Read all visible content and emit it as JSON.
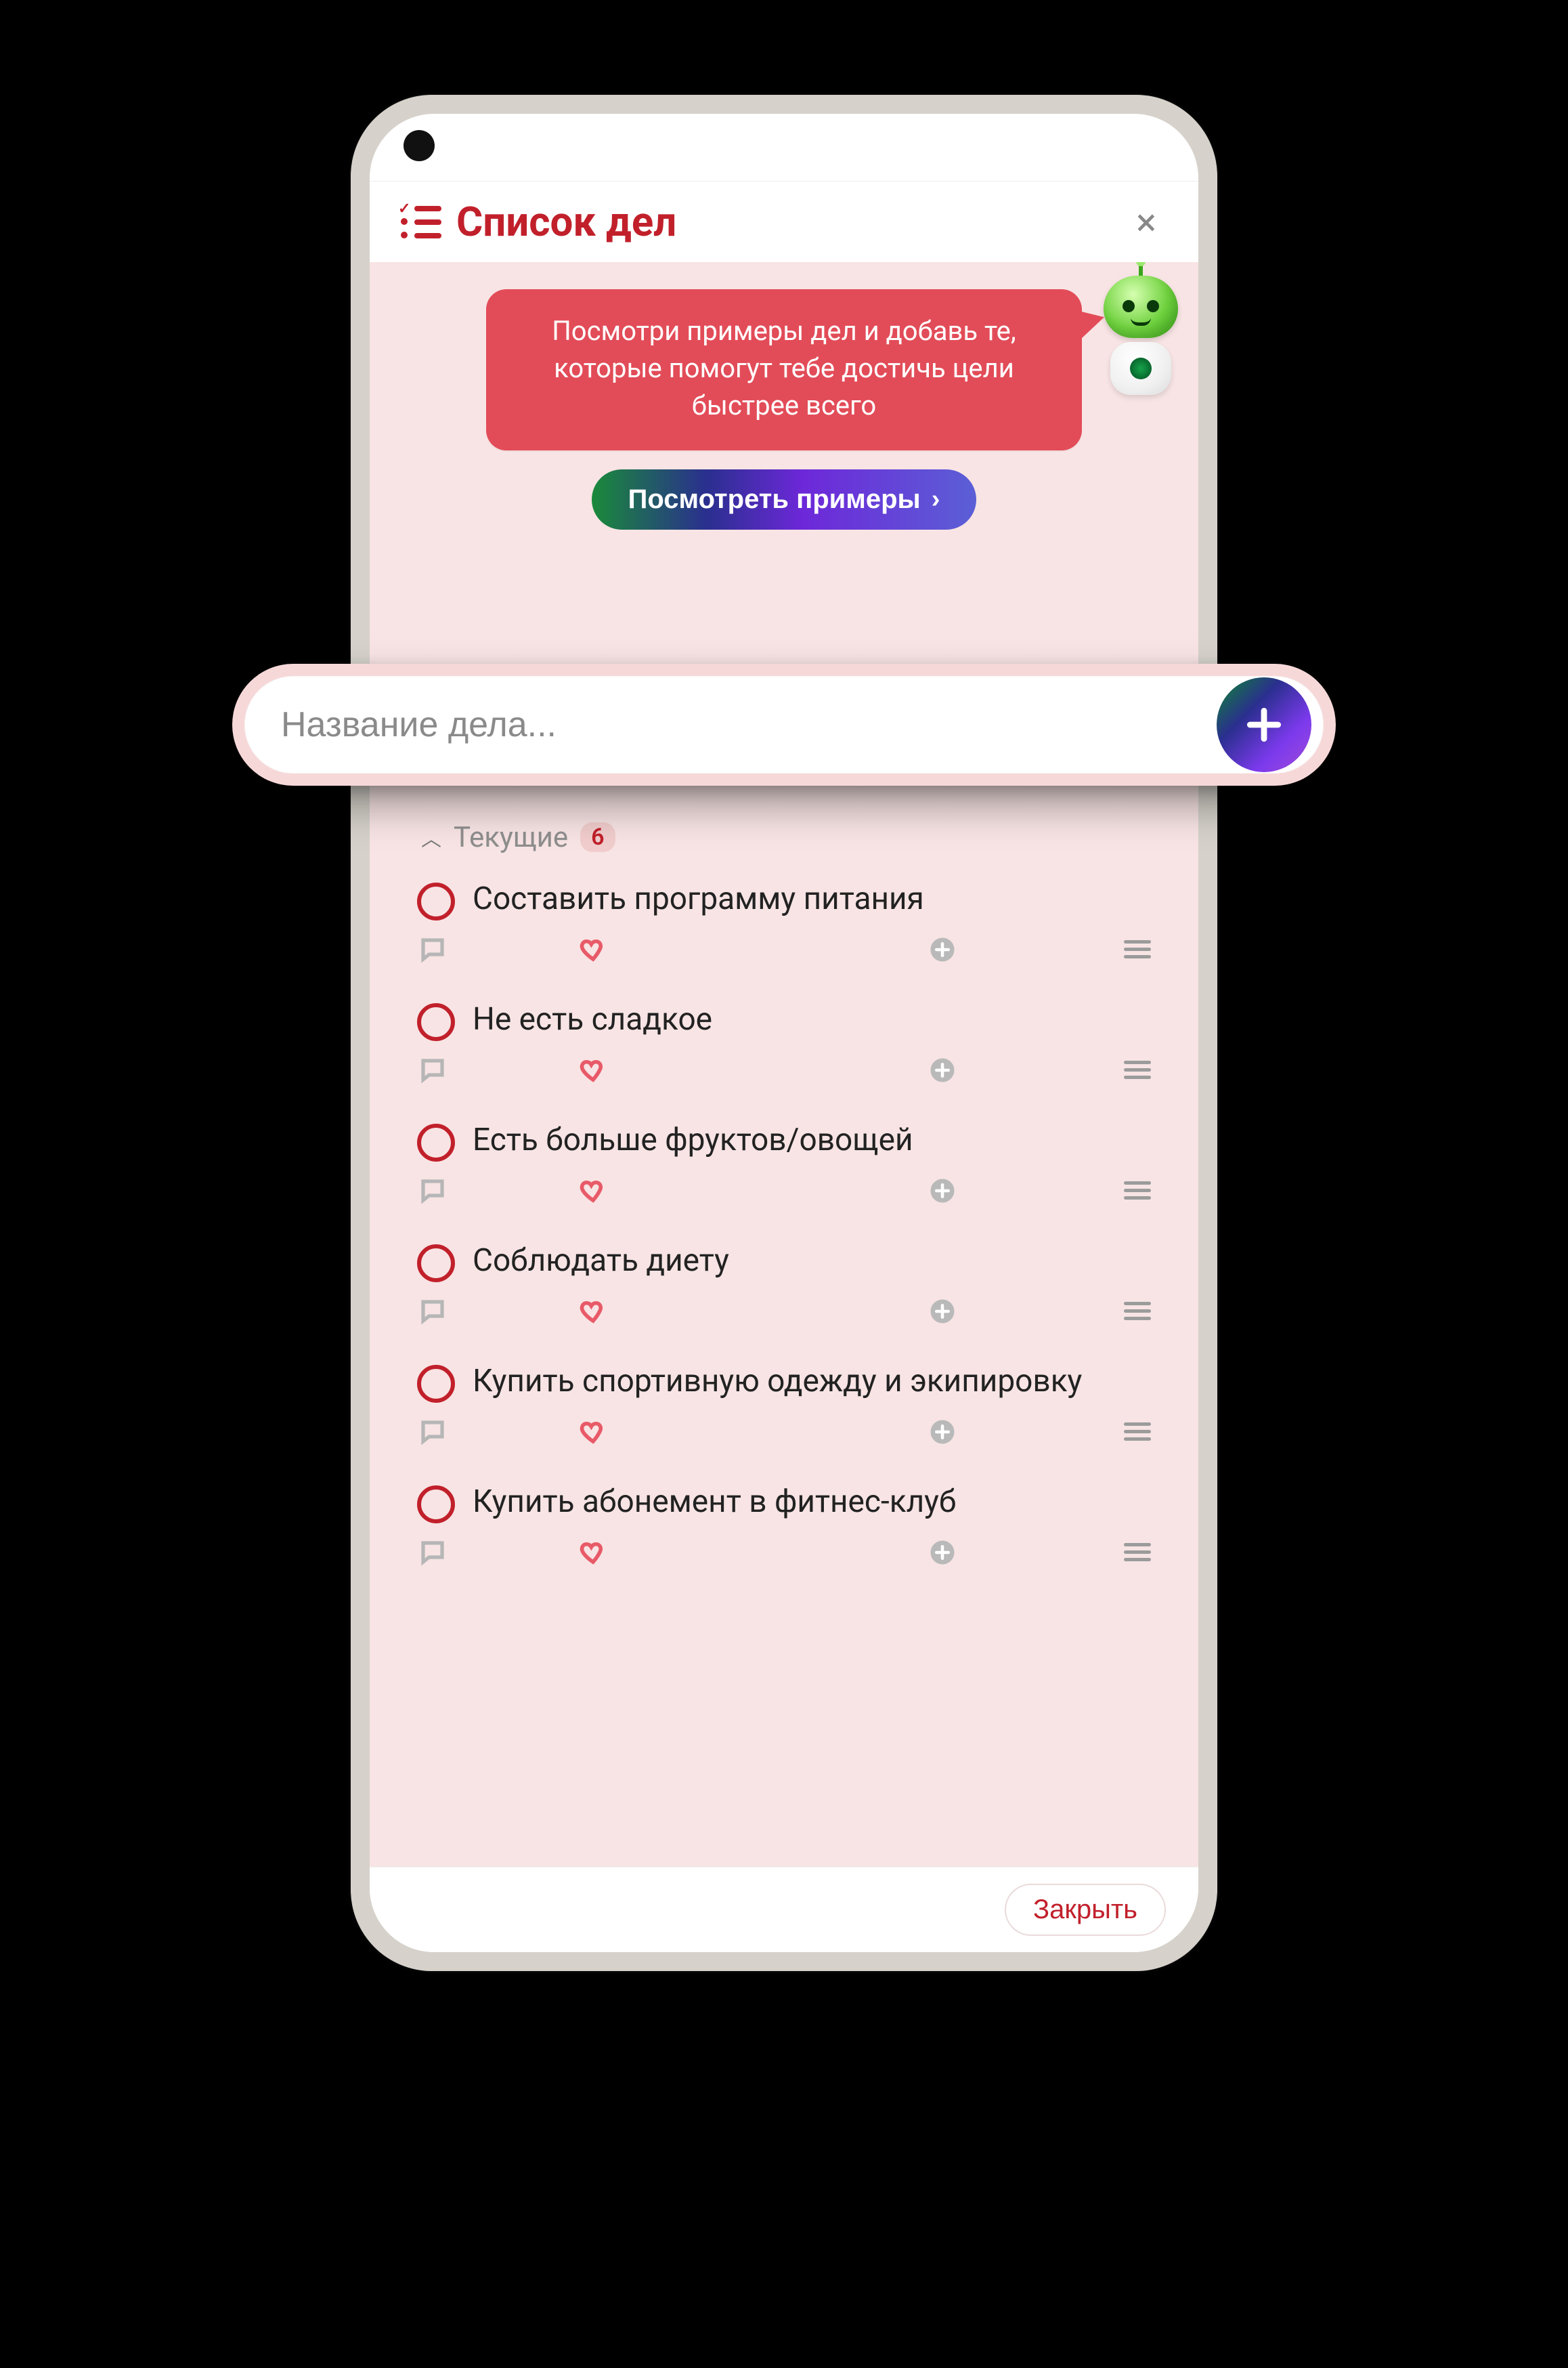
{
  "header": {
    "title": "Список дел"
  },
  "advice": {
    "text": "Посмотри примеры дел и добавь те, которые помогут тебе достичь цели быстрее всего",
    "button": "Посмотреть примеры"
  },
  "input": {
    "placeholder": "Название дела..."
  },
  "section": {
    "label": "Текущие",
    "count": "6"
  },
  "tasks": [
    {
      "title": "Составить программу питания"
    },
    {
      "title": "Не есть сладкое"
    },
    {
      "title": "Есть больше фруктов/овощей"
    },
    {
      "title": "Соблюдать диету"
    },
    {
      "title": "Купить спортивную одежду и экипировку"
    },
    {
      "title": "Купить абонемент в фитнес-клуб"
    }
  ],
  "footer": {
    "close": "Закрыть"
  }
}
